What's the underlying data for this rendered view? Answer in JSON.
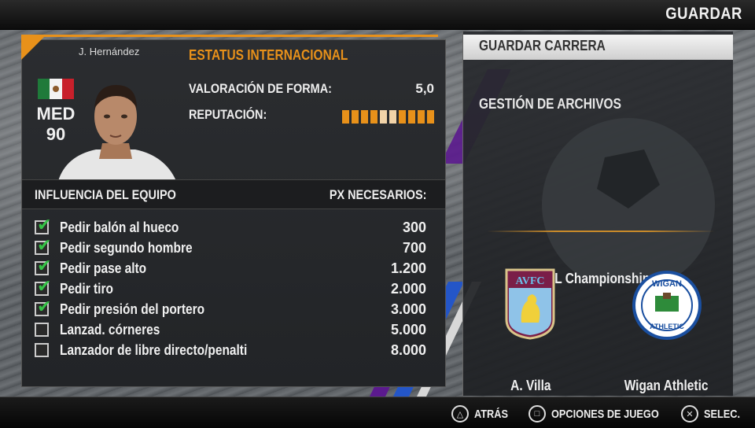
{
  "header": {
    "title": "GUARDAR"
  },
  "player": {
    "name": "J. Hernández",
    "position": "MED",
    "rating": "90",
    "flag_icon": "mexico-flag-icon"
  },
  "status": {
    "title": "ESTATUS INTERNACIONAL",
    "form_label": "VALORACIÓN DE FORMA:",
    "form_value": "5,0",
    "reputation_label": "REPUTACIÓN:",
    "reputation_segments_filled": 6,
    "reputation_segments_total": 10
  },
  "team_influence": {
    "header_left": "INFLUENCIA DEL EQUIPO",
    "header_right": "PX NECESARIOS:",
    "items": [
      {
        "label": "Pedir balón al hueco",
        "cost": "300",
        "checked": true
      },
      {
        "label": "Pedir segundo hombre",
        "cost": "700",
        "checked": true
      },
      {
        "label": "Pedir pase alto",
        "cost": "1.200",
        "checked": true
      },
      {
        "label": "Pedir tiro",
        "cost": "2.000",
        "checked": true
      },
      {
        "label": "Pedir presión del portero",
        "cost": "3.000",
        "checked": true
      },
      {
        "label": "Lanzad. córneres",
        "cost": "5.000",
        "checked": false
      },
      {
        "label": "Lanzador de libre directo/penalti",
        "cost": "8.000",
        "checked": false
      }
    ]
  },
  "save_menu": {
    "selected": "GUARDAR CARRERA",
    "option2": "GESTIÓN DE ARCHIVOS",
    "competition": "FL Championship",
    "home_team": "A. Villa",
    "home_crest_text": "AVFC",
    "away_team": "Wigan Athletic",
    "away_crest_top": "WIGAN",
    "away_crest_bottom": "ATHLETIC"
  },
  "footer": {
    "triangle_label": "ATRÁS",
    "square_label": "OPCIONES DE JUEGO",
    "cross_label": "SELEC."
  },
  "colors": {
    "accent_orange": "#e8911a",
    "check_green": "#36c247",
    "stripe_purple": "#5b1a8e",
    "stripe_blue": "#2456c8"
  }
}
